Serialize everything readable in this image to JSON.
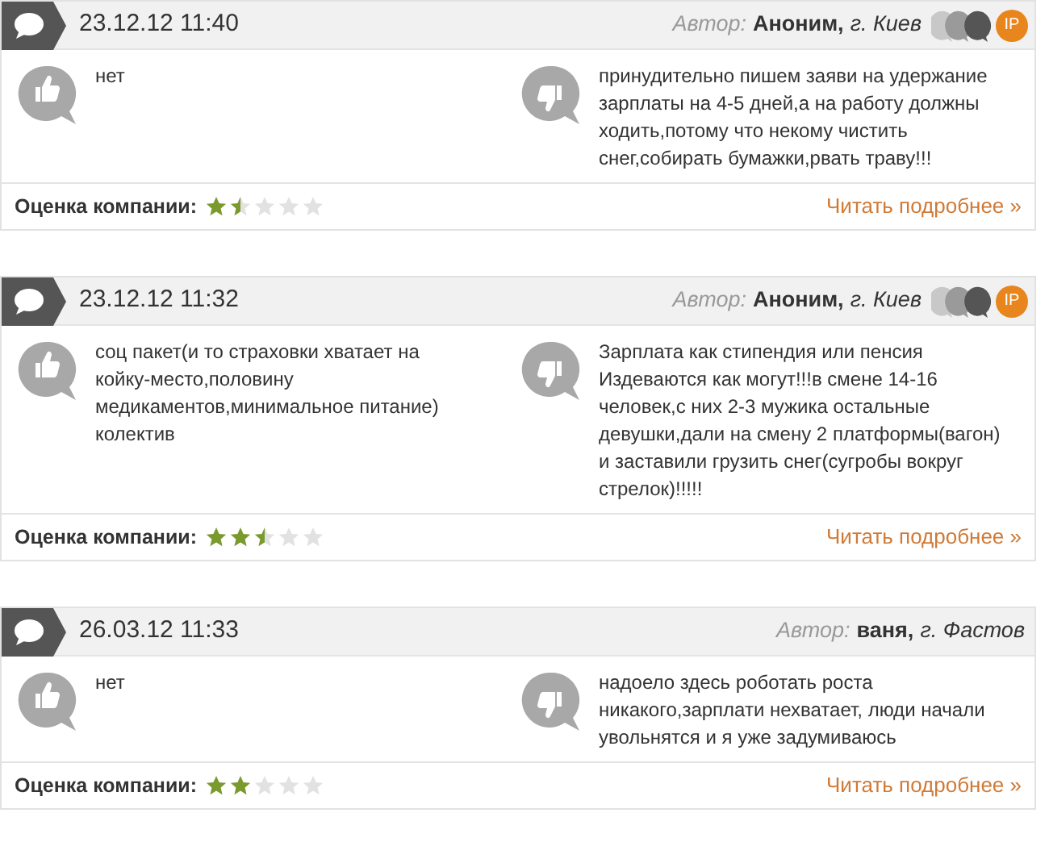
{
  "reviews": [
    {
      "datetime": "23.12.12 11:40",
      "author_label": "Автор:",
      "author": "Аноним,",
      "city": "г. Киев",
      "badge": "IP",
      "pros": "нет",
      "cons": "принудительно пишем заяви на удержание зарплаты на 4-5 дней,а на работу должны ходить,потому что некому чистить снег,собирать бумажки,рвать траву!!!",
      "rating_label": "Оценка компании:",
      "stars": 1.5,
      "more": "Читать подробнее »"
    },
    {
      "datetime": "23.12.12 11:32",
      "author_label": "Автор:",
      "author": "Аноним,",
      "city": "г. Киев",
      "badge": "IP",
      "pros": "соц пакет(и то страховки хватает на койку-место,половину медикаментов,минимальное питание) колектив",
      "cons": "Зарплата как стипендия или пенсия Издеваются как могут!!!в смене 14-16 человек,с них 2-3 мужика остальные девушки,дали на смену 2 платформы(вагон) и заставили грузить снег(сугробы вокруг стрелок)!!!!!",
      "rating_label": "Оценка компании:",
      "stars": 2.5,
      "more": "Читать подробнее »"
    },
    {
      "datetime": "26.03.12 11:33",
      "author_label": "Автор:",
      "author": "ваня,",
      "city": "г. Фастов",
      "pros": "нет",
      "cons": "надоело здесь роботать роста никакого,зарплати нехватает, люди начали увольнятся и я уже задумиваюсь",
      "rating_label": "Оценка компании:",
      "stars": 2,
      "more": "Читать подробнее »"
    }
  ]
}
